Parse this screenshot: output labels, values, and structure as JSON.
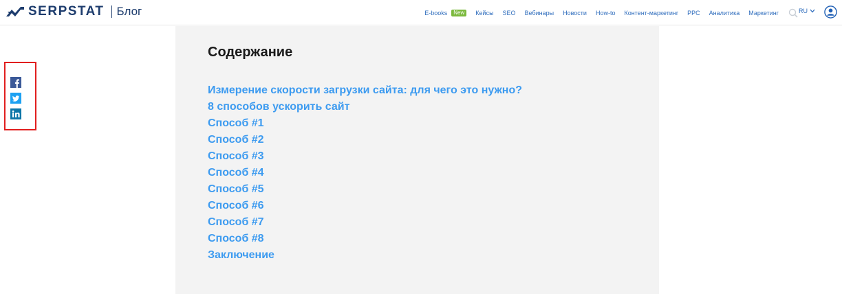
{
  "header": {
    "brand": "SERPSTAT",
    "section": "Блог",
    "nav": [
      {
        "label": "E-books",
        "badge": "New"
      },
      {
        "label": "Кейсы"
      },
      {
        "label": "SEO"
      },
      {
        "label": "Вебинары"
      },
      {
        "label": "Новости"
      },
      {
        "label": "How-to"
      },
      {
        "label": "Контент-маркетинг"
      },
      {
        "label": "PPC"
      },
      {
        "label": "Аналитика"
      },
      {
        "label": "Маркетинг"
      }
    ],
    "search_icon": "search-icon",
    "language": "RU",
    "user_icon": "user-icon"
  },
  "share": {
    "icons": [
      "facebook-icon",
      "twitter-icon",
      "linkedin-icon"
    ]
  },
  "toc": {
    "title": "Содержание",
    "items": [
      "Измерение скорости загрузки сайта: для чего это нужно?",
      "8 способов ускорить сайт",
      "Способ #1",
      "Способ #2",
      "Способ #3",
      "Способ #4",
      "Способ #5",
      "Способ #6",
      "Способ #7",
      "Способ #8",
      "Заключение"
    ]
  },
  "colors": {
    "brand": "#1d3c6d",
    "link": "#3d9bf0",
    "nav_link": "#2f6dbd",
    "badge": "#7bb93d",
    "highlight_border": "#e11e1e",
    "facebook": "#3b5998",
    "twitter": "#1da1f2",
    "linkedin": "#0e76a8"
  }
}
